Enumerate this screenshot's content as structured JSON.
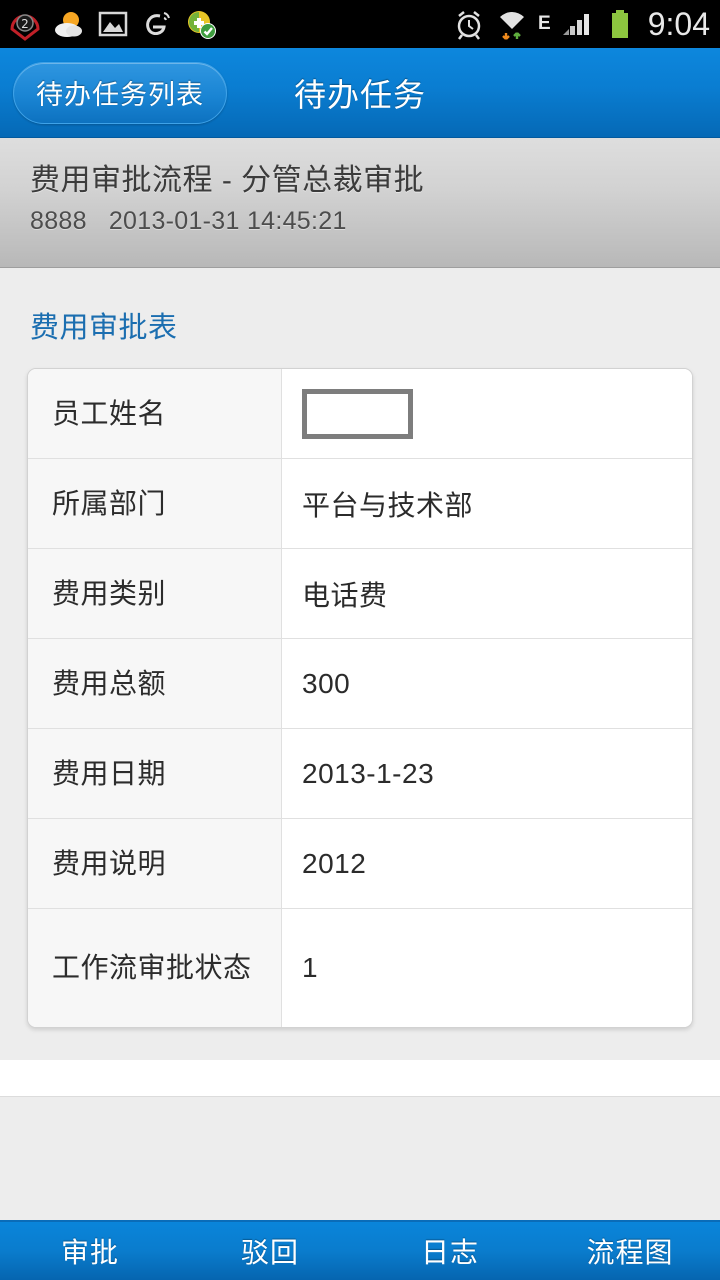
{
  "statusbar": {
    "time": "9:04",
    "network_label": "E",
    "left_icons": [
      "alarm-count-icon",
      "weather-icon",
      "gallery-icon",
      "uc-browser-icon",
      "security-shield-icon"
    ],
    "right_icons": [
      "alarm-clock-icon",
      "wifi-icon",
      "signal-bars-icon",
      "battery-icon"
    ]
  },
  "header": {
    "back_label": "待办任务列表",
    "title": "待办任务"
  },
  "task_info": {
    "title": "费用审批流程 - 分管总裁审批",
    "id": "8888",
    "timestamp": "2013-01-31 14:45:21"
  },
  "form": {
    "section_title": "费用审批表",
    "rows": [
      {
        "label": "员工姓名",
        "value": "",
        "value_is_tofu": true
      },
      {
        "label": "所属部门",
        "value": "平台与技术部"
      },
      {
        "label": "费用类别",
        "value": "电话费"
      },
      {
        "label": "费用总额",
        "value": "300"
      },
      {
        "label": "费用日期",
        "value": "2013-1-23"
      },
      {
        "label": "费用说明",
        "value": "2012"
      },
      {
        "label": "工作流审批状态",
        "value": "1",
        "tall": true
      }
    ]
  },
  "tabbar": {
    "tabs": [
      {
        "label": "审批",
        "name": "tab-approve"
      },
      {
        "label": "驳回",
        "name": "tab-reject"
      },
      {
        "label": "日志",
        "name": "tab-log"
      },
      {
        "label": "流程图",
        "name": "tab-flowchart"
      }
    ]
  },
  "colors": {
    "accent_blue": "#0a7dd1",
    "section_title_blue": "#1b6eb0",
    "page_bg": "#ededed",
    "info_bar_gray": "#d2d2d2",
    "battery_green": "#8cc63f"
  }
}
